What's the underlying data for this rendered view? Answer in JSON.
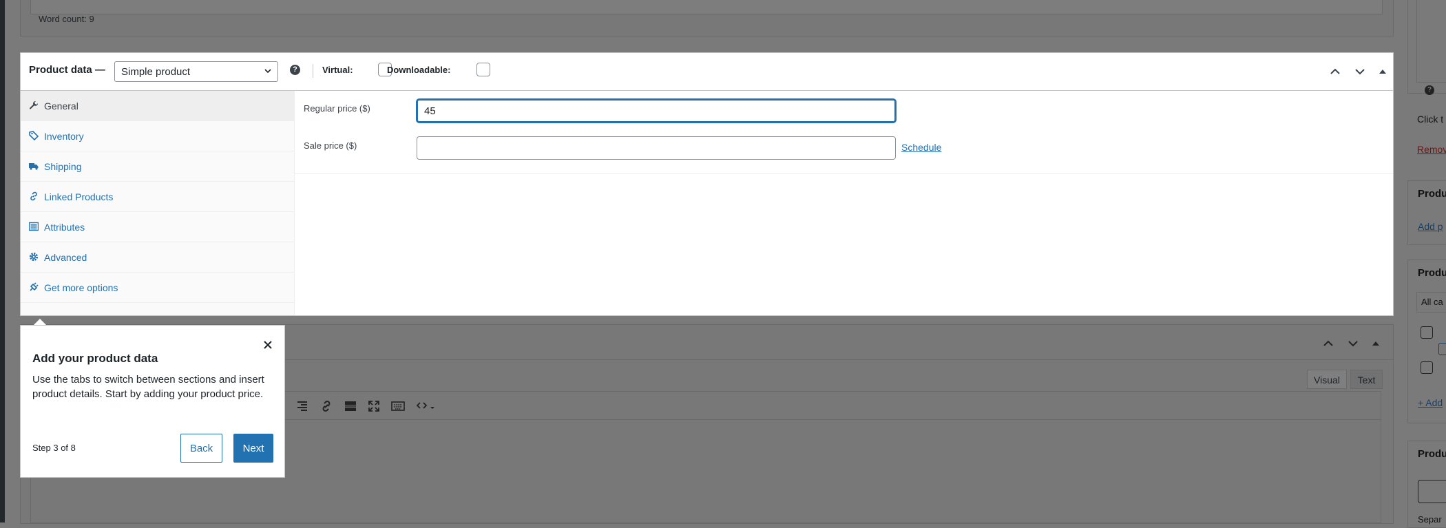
{
  "top_editor": {
    "word_count": "Word count: 9"
  },
  "product_data": {
    "title": "Product data —",
    "type_select": "Simple product",
    "help": "?",
    "virtual_label": "Virtual:",
    "downloadable_label": "Downloadable:",
    "tabs": [
      {
        "label": "General",
        "icon": "wrench-icon"
      },
      {
        "label": "Inventory",
        "icon": "tag-icon"
      },
      {
        "label": "Shipping",
        "icon": "truck-icon"
      },
      {
        "label": "Linked Products",
        "icon": "link-icon"
      },
      {
        "label": "Attributes",
        "icon": "list-icon"
      },
      {
        "label": "Advanced",
        "icon": "gear-icon"
      },
      {
        "label": "Get more options",
        "icon": "plugin-icon"
      }
    ],
    "general": {
      "regular_price_label": "Regular price ($)",
      "regular_price_value": "45",
      "sale_price_label": "Sale price ($)",
      "sale_price_value": "",
      "schedule_link": "Schedule"
    }
  },
  "description_editor": {
    "visual_tab": "Visual",
    "text_tab": "Text"
  },
  "sidebar": {
    "help": "?",
    "click_text": "Click t",
    "remove_link": "Remov",
    "panel1_title": "Produ",
    "panel1_link": "Add p",
    "panel2_title": "Produ",
    "all_categories": "All ca",
    "add_link": "+ Add",
    "panel3_title": "Produ",
    "sep_text": "Separ"
  },
  "tour": {
    "title": "Add your product data",
    "body": "Use the tabs to switch between sections and insert product details. Start by adding your product price.",
    "step": "Step 3 of 8",
    "back_label": "Back",
    "next_label": "Next"
  }
}
